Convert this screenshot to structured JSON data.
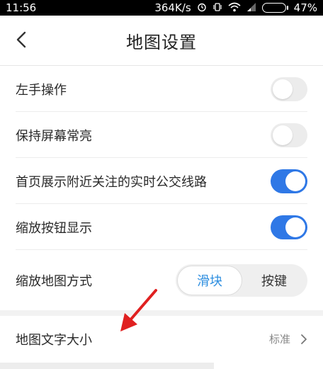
{
  "status_bar": {
    "time": "11:56",
    "network_speed": "364K/s",
    "battery_percent": "47%",
    "battery_level": 0.47,
    "icons": [
      "alarm-icon",
      "vibrate-icon",
      "wifi-icon",
      "signal-icon",
      "battery-icon"
    ]
  },
  "header": {
    "title": "地图设置",
    "back_icon": "chevron-left-icon"
  },
  "settings": [
    {
      "label": "左手操作",
      "state": "off"
    },
    {
      "label": "保持屏幕常亮",
      "state": "off"
    },
    {
      "label": "首页展示附近关注的实时公交线路",
      "state": "on"
    },
    {
      "label": "缩放按钮显示",
      "state": "on"
    }
  ],
  "zoom_mode": {
    "label": "缩放地图方式",
    "options": [
      "滑块",
      "按键"
    ],
    "selected": "滑块"
  },
  "map_text_size": {
    "label": "地图文字大小",
    "value": "标准",
    "icon": "chevron-right-icon"
  },
  "colors": {
    "toggle_on": "#2f78e6",
    "toggle_off": "#ececec",
    "segment_active_text": "#2f8fe0",
    "annotation_arrow": "#e02020"
  }
}
